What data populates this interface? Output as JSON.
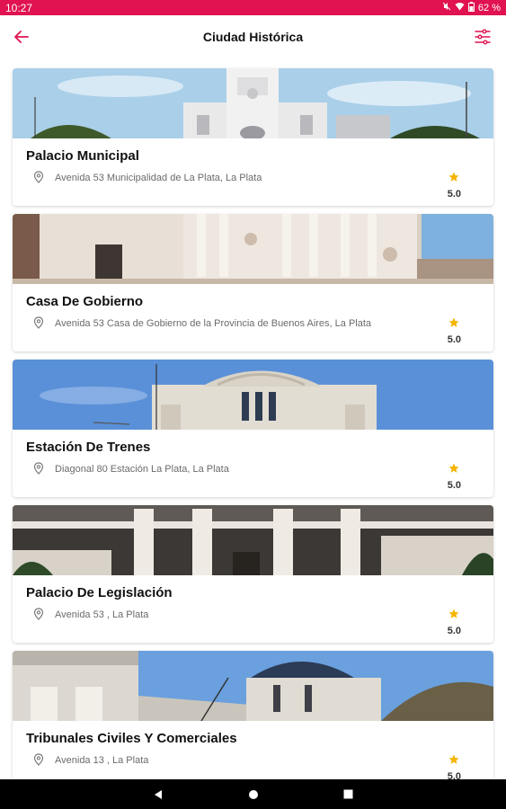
{
  "status_bar": {
    "time": "10:27",
    "battery": "62 %",
    "icons": [
      "mute-icon",
      "wifi-icon",
      "battery-icon"
    ]
  },
  "header": {
    "title": "Ciudad Histórica",
    "back_icon": "arrow-left-icon",
    "filter_icon": "filter-icon"
  },
  "colors": {
    "accent": "#e0124f",
    "star": "#f5b400"
  },
  "places": [
    {
      "name": "Palacio Municipal",
      "address": "Avenida 53 Municipalidad de La Plata, La Plata",
      "rating": "5.0"
    },
    {
      "name": "Casa De Gobierno",
      "address": "Avenida 53 Casa de Gobierno de la Provincia de Buenos Aires, La Plata",
      "rating": "5.0"
    },
    {
      "name": "Estación De Trenes",
      "address": "Diagonal 80 Estación La Plata, La Plata",
      "rating": "5.0"
    },
    {
      "name": "Palacio De Legislación",
      "address": "Avenida 53 , La Plata",
      "rating": "5.0"
    },
    {
      "name": "Tribunales Civiles Y Comerciales",
      "address": "Avenida 13 , La Plata",
      "rating": "5.0"
    }
  ],
  "nav_bar": {
    "icons": [
      "back-triangle-icon",
      "home-circle-icon",
      "recents-square-icon"
    ]
  }
}
